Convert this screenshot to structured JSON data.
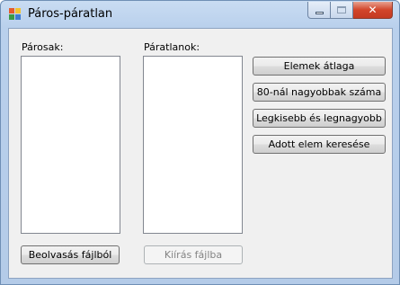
{
  "window": {
    "title": "Páros-páratlan"
  },
  "labels": {
    "even": "Párosak:",
    "odd": "Páratlanok:"
  },
  "buttons": {
    "average": "Elemek átlaga",
    "count_over_80": "80-nál nagyobbak száma",
    "min_max": "Legkisebb és legnagyobb",
    "search": "Adott elem keresése",
    "read_file": "Beolvasás fájlból",
    "write_file": "Kiírás fájlba"
  },
  "lists": {
    "even_items": [],
    "odd_items": []
  },
  "state": {
    "write_file_enabled": false
  },
  "colors": {
    "titlebar": "#b9d0ec",
    "close_button": "#d2452a",
    "client_background": "#f0f0f0"
  }
}
